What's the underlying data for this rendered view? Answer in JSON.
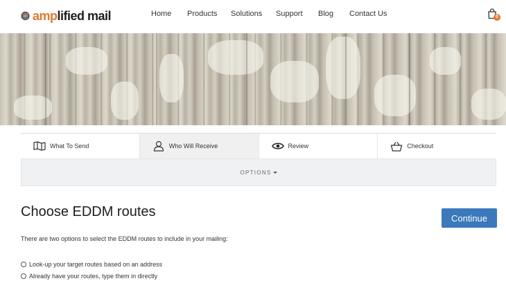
{
  "header": {
    "logo": {
      "amp": "amp",
      "rest": "lified mail"
    },
    "nav": [
      {
        "label": "Home"
      },
      {
        "label": "Products"
      },
      {
        "label": "Solutions"
      },
      {
        "label": "Support"
      },
      {
        "label": "Blog"
      },
      {
        "label": "Contact Us"
      }
    ],
    "cart_count": "0"
  },
  "steps": [
    {
      "label": "What To Send",
      "icon": "map-icon",
      "active": false
    },
    {
      "label": "Who Will Receive",
      "icon": "person-icon",
      "active": true
    },
    {
      "label": "Review",
      "icon": "eye-icon",
      "active": false
    },
    {
      "label": "Checkout",
      "icon": "basket-icon",
      "active": false
    }
  ],
  "options_label": "OPTIONS",
  "main": {
    "title": "Choose EDDM routes",
    "continue_label": "Continue",
    "intro": "There are two options to select the EDDM routes to include in your mailing:",
    "radio_options": [
      {
        "label": "Look-up your target routes based on an address",
        "checked": false
      },
      {
        "label": "Already have your routes, type them in directly",
        "checked": false
      }
    ]
  },
  "colors": {
    "accent_orange": "#e8772e",
    "button_blue": "#3a79bb",
    "options_bg": "#f0f1f3",
    "active_step_bg": "#f0f0f0"
  }
}
